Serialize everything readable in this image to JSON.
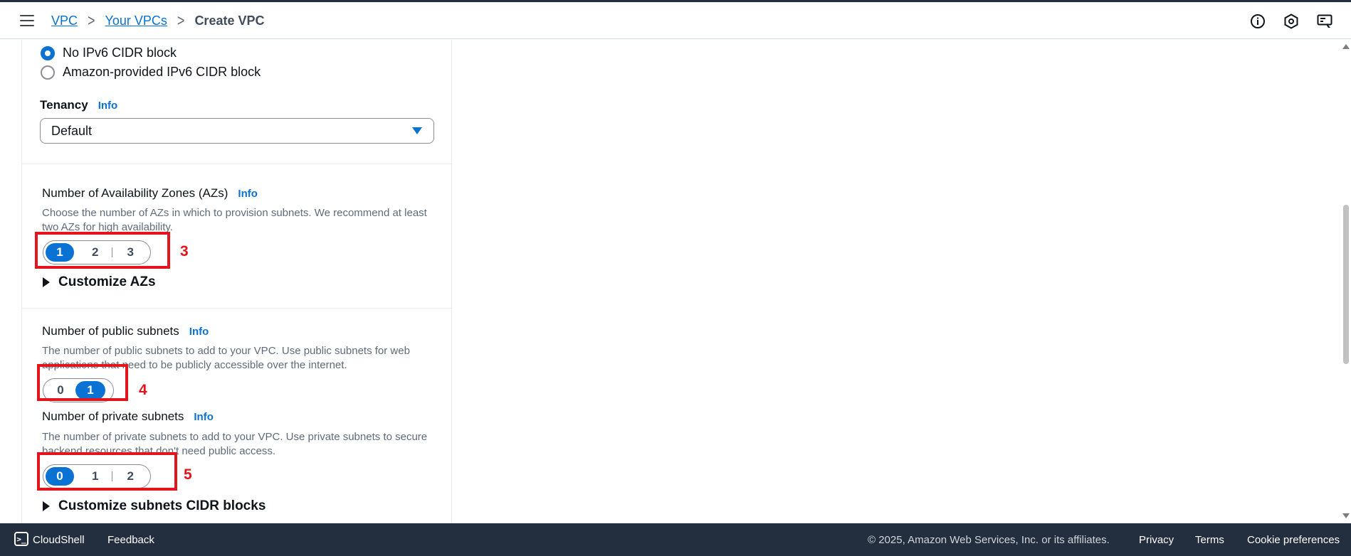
{
  "breadcrumbs": [
    {
      "label": "VPC"
    },
    {
      "label": "Your VPCs"
    },
    {
      "label": "Create VPC"
    }
  ],
  "header_icons": [
    "info-circle-icon",
    "settings-hexagon-icon",
    "notifications-icon"
  ],
  "ipv6": {
    "options": [
      {
        "label": "No IPv6 CIDR block",
        "checked": true
      },
      {
        "label": "Amazon-provided IPv6 CIDR block",
        "checked": false
      }
    ]
  },
  "tenancy": {
    "label": "Tenancy",
    "info": "Info",
    "value": "Default"
  },
  "azs": {
    "label": "Number of Availability Zones (AZs)",
    "info": "Info",
    "description": "Choose the number of AZs in which to provision subnets. We recommend at least two AZs for high availability.",
    "options": [
      "1",
      "2",
      "3"
    ],
    "selected": "1",
    "customize": "Customize AZs",
    "annotation": "3"
  },
  "public_subnets": {
    "label": "Number of public subnets",
    "info": "Info",
    "description": "The number of public subnets to add to your VPC. Use public subnets for web applications that need to be publicly accessible over the internet.",
    "options": [
      "0",
      "1"
    ],
    "selected": "1",
    "annotation": "4"
  },
  "private_subnets": {
    "label": "Number of private subnets",
    "info": "Info",
    "description": "The number of private subnets to add to your VPC. Use private subnets to secure backend resources that don't need public access.",
    "options": [
      "0",
      "1",
      "2"
    ],
    "selected": "0",
    "customize": "Customize subnets CIDR blocks",
    "annotation": "5"
  },
  "colors": {
    "accent": "#0972d3",
    "annotation": "#e3141b",
    "footer_bg": "#232f3e"
  },
  "footer": {
    "cloudshell": "CloudShell",
    "feedback": "Feedback",
    "copyright": "© 2025, Amazon Web Services, Inc. or its affiliates.",
    "privacy": "Privacy",
    "terms": "Terms",
    "cookie": "Cookie preferences"
  }
}
